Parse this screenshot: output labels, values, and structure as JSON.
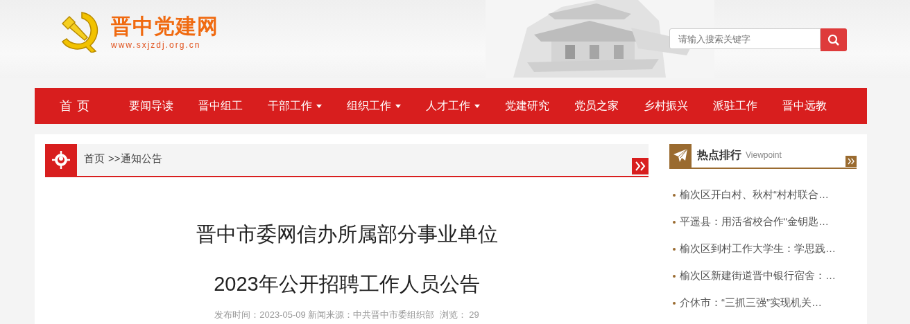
{
  "header": {
    "site_name": "晋中党建网",
    "site_url": "www.sxjzdj.org.cn",
    "search": {
      "placeholder": "请输入搜索关键字"
    }
  },
  "nav": [
    {
      "label": "首 页",
      "kind": "home",
      "has_menu": false
    },
    {
      "label": "要闻导读",
      "kind": "link",
      "has_menu": false
    },
    {
      "label": "晋中组工",
      "kind": "link",
      "has_menu": false
    },
    {
      "label": "干部工作",
      "kind": "link",
      "has_menu": true
    },
    {
      "label": "组织工作",
      "kind": "link",
      "has_menu": true
    },
    {
      "label": "人才工作",
      "kind": "link",
      "has_menu": true
    },
    {
      "label": "党建研究",
      "kind": "link",
      "has_menu": false
    },
    {
      "label": "党员之家",
      "kind": "link",
      "has_menu": false
    },
    {
      "label": "乡村振兴",
      "kind": "link",
      "has_menu": false
    },
    {
      "label": "派驻工作",
      "kind": "link",
      "has_menu": false
    },
    {
      "label": "晋中远教",
      "kind": "link",
      "has_menu": false
    }
  ],
  "breadcrumb": {
    "home": "首页",
    "separator": ">>",
    "current": "通知公告"
  },
  "article": {
    "title_lines": [
      "晋中市委网信办所属部分事业单位",
      "2023年公开招聘工作人员公告"
    ],
    "meta": "发布时间：2023-05-09 新闻来源：中共晋中市委组织部  浏览： 29"
  },
  "hot": {
    "title": "热点排行",
    "subtitle": "Viewpoint",
    "items": [
      "榆次区开白村、秋村“村村联合…",
      "平遥县：用活省校合作“金钥匙…",
      "榆次区到村工作大学生：学思践…",
      "榆次区新建街道晋中银行宿舍：…",
      "介休市：“三抓三强”实现机关…"
    ]
  }
}
